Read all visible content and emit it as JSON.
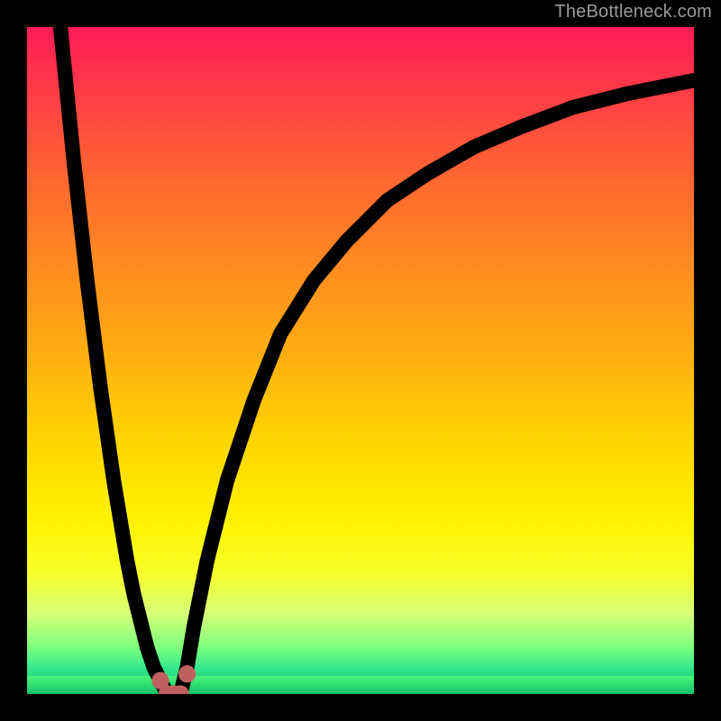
{
  "watermark": "TheBottleneck.com",
  "chart_data": {
    "type": "line",
    "title": "",
    "xlabel": "",
    "ylabel": "",
    "xlim": [
      0,
      100
    ],
    "ylim": [
      0,
      100
    ],
    "grid": false,
    "legend": false,
    "gradient_stops": [
      {
        "pos": 0,
        "color": "#ff1c55"
      },
      {
        "pos": 6,
        "color": "#ff2f4d"
      },
      {
        "pos": 14,
        "color": "#ff4a3f"
      },
      {
        "pos": 24,
        "color": "#ff6a2e"
      },
      {
        "pos": 36,
        "color": "#ff8c20"
      },
      {
        "pos": 48,
        "color": "#ffab12"
      },
      {
        "pos": 62,
        "color": "#ffd500"
      },
      {
        "pos": 74,
        "color": "#fff200"
      },
      {
        "pos": 82,
        "color": "#f6ff2a"
      },
      {
        "pos": 88,
        "color": "#d6ff78"
      },
      {
        "pos": 93,
        "color": "#7dff7d"
      },
      {
        "pos": 96,
        "color": "#35e98c"
      },
      {
        "pos": 98,
        "color": "#1fd37a"
      },
      {
        "pos": 100,
        "color": "#15c269"
      }
    ],
    "series": [
      {
        "name": "left-branch",
        "x": [
          5,
          6,
          7,
          8,
          9,
          10,
          11,
          12,
          13,
          14,
          15,
          16,
          17,
          18,
          19,
          20,
          21
        ],
        "y": [
          100,
          90,
          80,
          71,
          62,
          54,
          46,
          39,
          32,
          26,
          20,
          15,
          11,
          7,
          4,
          2,
          0
        ]
      },
      {
        "name": "right-branch",
        "x": [
          23,
          24,
          25,
          27,
          30,
          34,
          38,
          43,
          48,
          54,
          60,
          67,
          74,
          82,
          90,
          100
        ],
        "y": [
          0,
          4,
          10,
          20,
          32,
          44,
          54,
          62,
          68,
          74,
          78,
          82,
          85,
          88,
          90,
          92
        ]
      }
    ],
    "valley_markers": {
      "x": [
        20,
        21,
        22,
        23,
        24
      ],
      "y": [
        2,
        0,
        0,
        0,
        3
      ]
    },
    "optimum_x": 22
  }
}
